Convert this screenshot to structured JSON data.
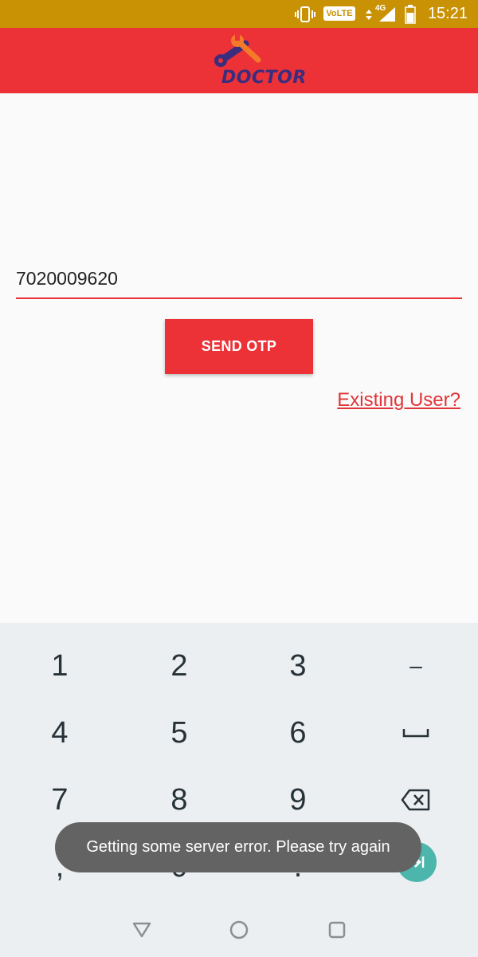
{
  "status_bar": {
    "time": "15:21",
    "network": "4G",
    "volte_label": "VoLTE",
    "icons": [
      "vibrate-icon",
      "volte-badge",
      "data-arrows-icon",
      "signal-icon",
      "battery-icon"
    ]
  },
  "app_bar": {
    "logo_text": "DOCTOR",
    "logo_icon": "wrench-icon",
    "background": "#ec3237"
  },
  "form": {
    "phone_value": "7020009620",
    "send_otp_label": "SEND OTP",
    "existing_user_label": "Existing User?"
  },
  "keyboard": {
    "rows": [
      [
        "1",
        "2",
        "3",
        "–"
      ],
      [
        "4",
        "5",
        "6",
        "space"
      ],
      [
        "7",
        "8",
        "9",
        "backspace"
      ],
      [
        ",",
        "0",
        ".",
        "next"
      ]
    ],
    "key_labels": {
      "k1": "1",
      "k2": "2",
      "k3": "3",
      "kdash": "–",
      "k4": "4",
      "k5": "5",
      "k6": "6",
      "k7": "7",
      "k8": "8",
      "k9": "9",
      "kcomma": ",",
      "k0": "0",
      "kdot": "."
    },
    "accent": "#4db6ac"
  },
  "toast": {
    "message": "Getting some server error. Please try again"
  },
  "nav_bar": {
    "buttons": [
      "back-icon",
      "home-icon",
      "recents-icon"
    ]
  },
  "colors": {
    "primary": "#ec3237",
    "status_bar": "#c99204",
    "background": "#fafafa",
    "keyboard": "#eceff1",
    "logo_text": "#3a2d7e",
    "logo_accent": "#f47a2a"
  }
}
